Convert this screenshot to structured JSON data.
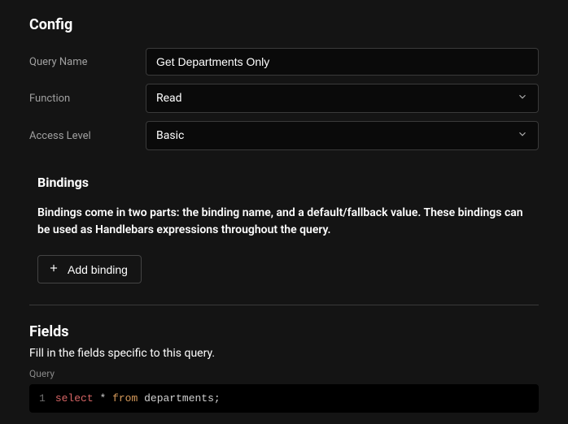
{
  "config": {
    "title": "Config",
    "queryName": {
      "label": "Query Name",
      "value": "Get Departments Only"
    },
    "function": {
      "label": "Function",
      "selected": "Read"
    },
    "accessLevel": {
      "label": "Access Level",
      "selected": "Basic"
    }
  },
  "bindings": {
    "title": "Bindings",
    "description": "Bindings come in two parts: the binding name, and a default/fallback value. These bindings can be used as Handlebars expressions throughout the query.",
    "addButton": "Add binding"
  },
  "fields": {
    "title": "Fields",
    "description": "Fill in the fields specific to this query.",
    "queryLabel": "Query",
    "code": {
      "lineNumber": "1",
      "tokens": {
        "select": "select",
        "star": "*",
        "from": "from",
        "table": "departments",
        "semi": ";"
      }
    }
  }
}
